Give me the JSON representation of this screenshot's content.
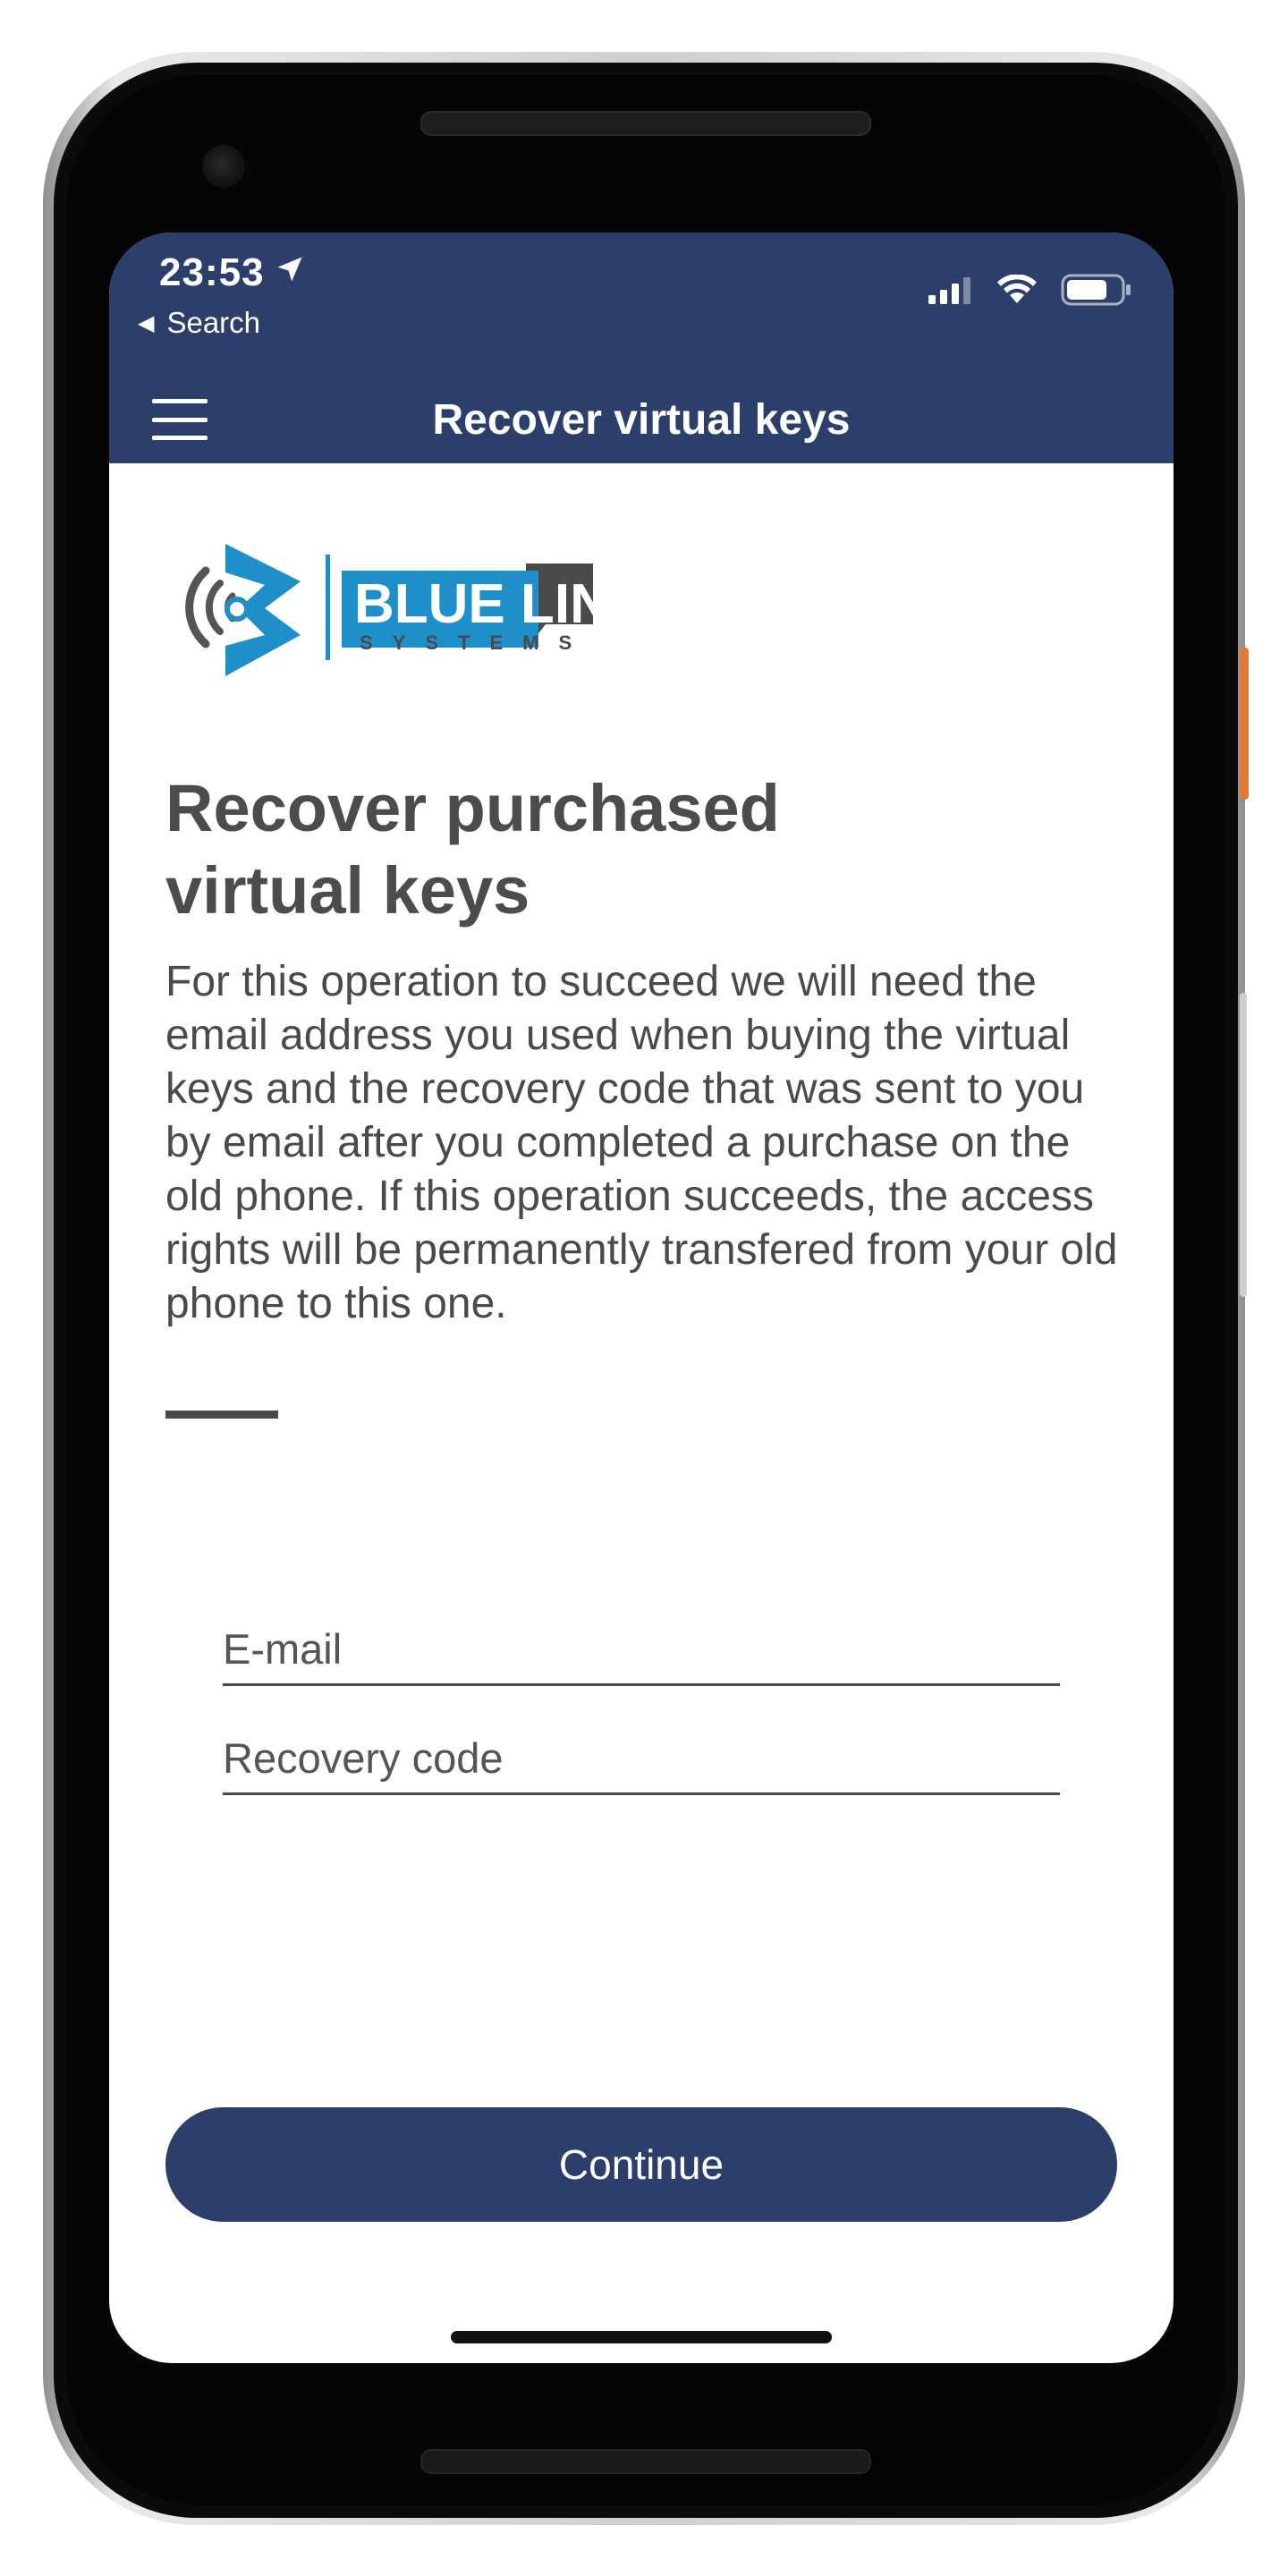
{
  "status_bar": {
    "time": "23:53",
    "back_label": "Search"
  },
  "header": {
    "title": "Recover virtual keys"
  },
  "logo": {
    "text_main": "BLUE LINK",
    "text_sub": "SYSTEMS",
    "colors": {
      "primary": "#1e8fc9",
      "secondary": "#4a4a4a"
    }
  },
  "main": {
    "heading_line1": "Recover purchased",
    "heading_line2": "virtual keys",
    "description": "For this operation to succeed we will need the email address you used when buying the virtual keys and the recovery code that was sent to you by email after you completed a purchase on the old phone. If this operation succeeds, the access rights will be permanently transfered from your old phone to this one.",
    "email_placeholder": "E-mail",
    "recovery_code_placeholder": "Recovery code",
    "continue_label": "Continue"
  },
  "colors": {
    "brand": "#2c3f6b",
    "text": "#4a4a4a",
    "background": "#ffffff"
  }
}
